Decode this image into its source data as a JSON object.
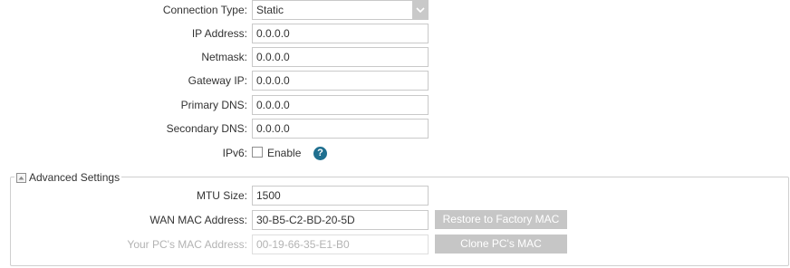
{
  "connection_type": {
    "label": "Connection Type:",
    "value": "Static"
  },
  "ip_address": {
    "label": "IP Address:",
    "value": "0.0.0.0"
  },
  "netmask": {
    "label": "Netmask:",
    "value": "0.0.0.0"
  },
  "gateway_ip": {
    "label": "Gateway IP:",
    "value": "0.0.0.0"
  },
  "primary_dns": {
    "label": "Primary DNS:",
    "value": "0.0.0.0"
  },
  "secondary_dns": {
    "label": "Secondary DNS:",
    "value": "0.0.0.0"
  },
  "ipv6": {
    "label": "IPv6:",
    "checkbox_label": "Enable",
    "checked": false,
    "help_glyph": "?",
    "help_icon": "help-icon"
  },
  "advanced": {
    "legend": "Advanced Settings",
    "toggle_icon": "collapse-up-icon",
    "mtu": {
      "label": "MTU Size:",
      "value": "1500"
    },
    "wan_mac": {
      "label": "WAN MAC Address:",
      "value": "30-B5-C2-BD-20-5D",
      "button": "Restore to Factory MAC"
    },
    "pc_mac": {
      "label": "Your PC's MAC Address:",
      "value": "00-19-66-35-E1-B0",
      "button": "Clone PC's MAC"
    }
  },
  "colors": {
    "text": "#333333",
    "disabled_text": "#b3b3b3",
    "field_border": "#c9c9c9",
    "button_bg": "#c6c6c6",
    "help_icon": "#1f6f8f"
  }
}
